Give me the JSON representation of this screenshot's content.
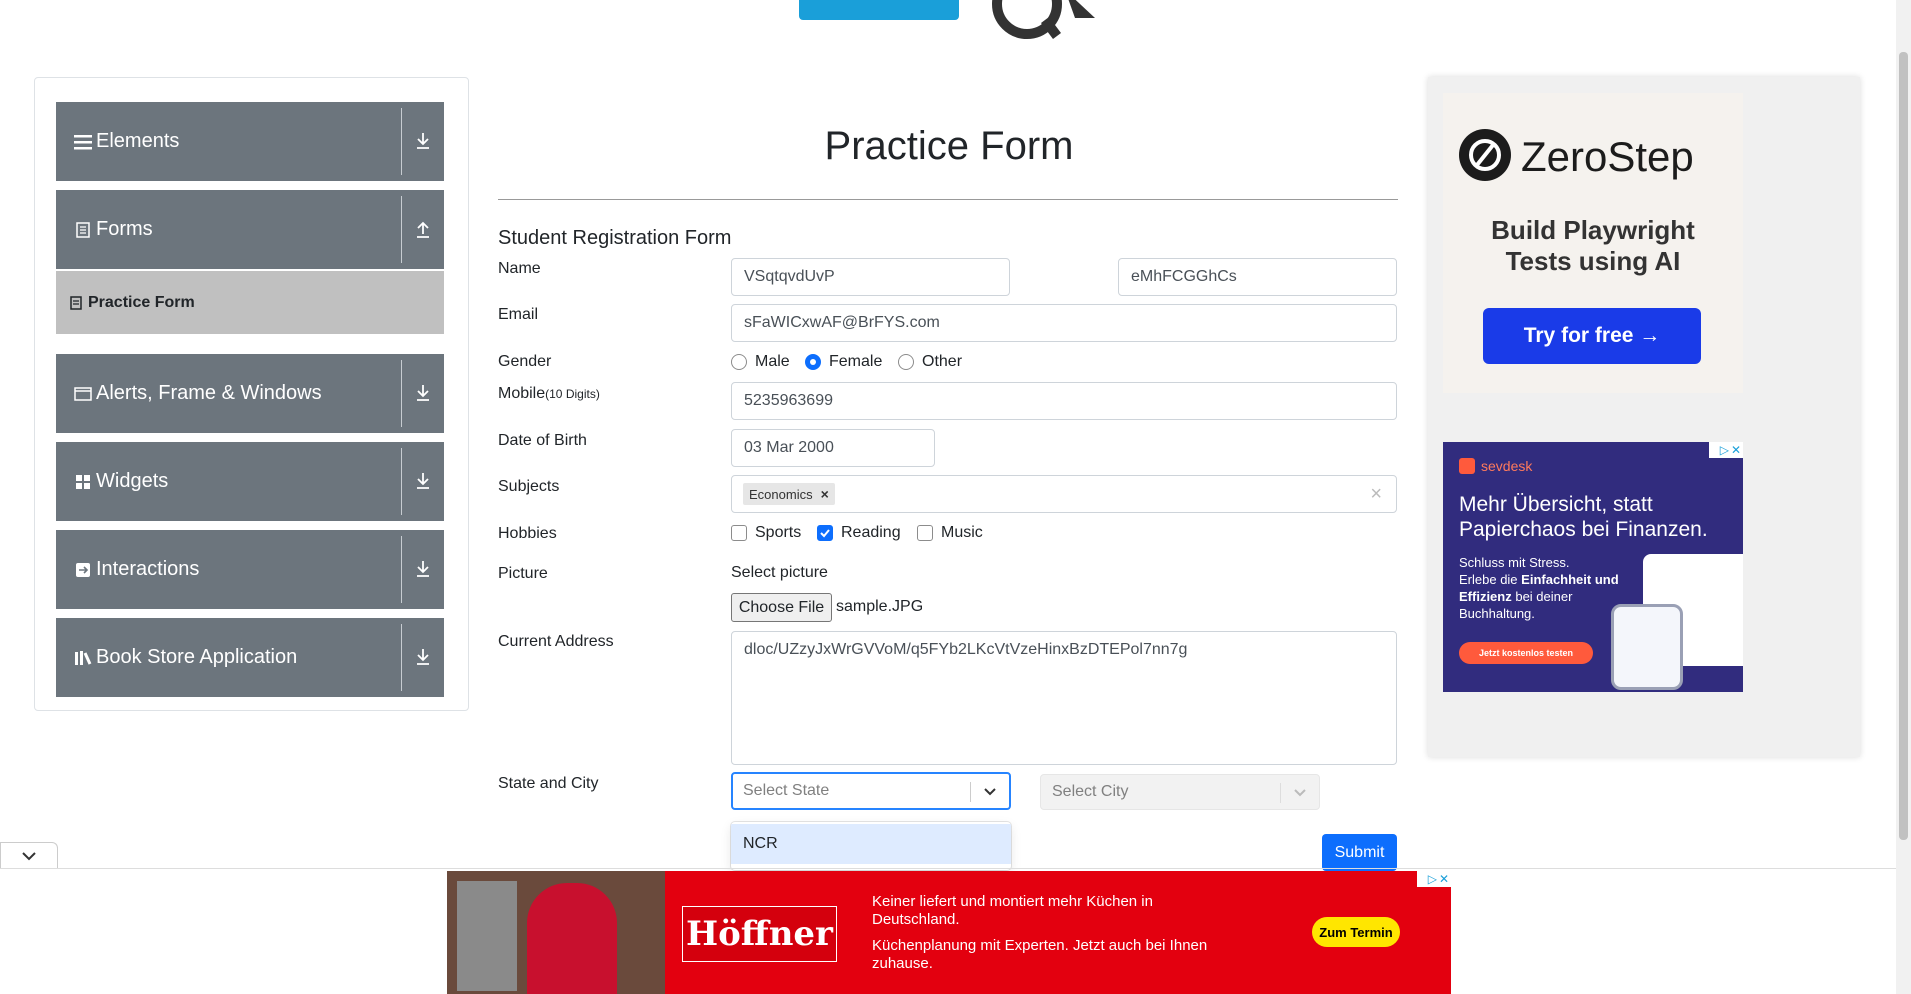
{
  "sidebar": {
    "groups": [
      {
        "label": "Elements",
        "icon": "list-icon",
        "arrow": "download-arrow-icon"
      },
      {
        "label": "Forms",
        "icon": "document-icon",
        "arrow": "upload-arrow-icon"
      },
      {
        "label": "Alerts, Frame & Windows",
        "icon": "window-icon",
        "arrow": "download-arrow-icon"
      },
      {
        "label": "Widgets",
        "icon": "widgets-icon",
        "arrow": "download-arrow-icon"
      },
      {
        "label": "Interactions",
        "icon": "interaction-icon",
        "arrow": "download-arrow-icon"
      },
      {
        "label": "Book Store Application",
        "icon": "books-icon",
        "arrow": "download-arrow-icon"
      }
    ],
    "active_item": "Practice Form"
  },
  "main": {
    "page_title": "Practice Form",
    "form_title": "Student Registration Form",
    "name_label": "Name",
    "first_name": "VSqtqvdUvP",
    "last_name": "eMhFCGGhCs",
    "email_label": "Email",
    "email": "sFaWICxwAF@BrFYS.com",
    "gender_label": "Gender",
    "gender_options": [
      "Male",
      "Female",
      "Other"
    ],
    "gender_selected": "Female",
    "mobile_label": "Mobile",
    "mobile_hint": "(10 Digits)",
    "mobile": "5235963699",
    "dob_label": "Date of Birth",
    "dob": "03 Mar 2000",
    "subjects_label": "Subjects",
    "subjects": [
      "Economics"
    ],
    "hobbies_label": "Hobbies",
    "hobbies": [
      "Sports",
      "Reading",
      "Music"
    ],
    "hobbies_checked": [
      "Reading"
    ],
    "picture_label": "Picture",
    "select_picture": "Select picture",
    "choose_file": "Choose File",
    "file_name": "sample.JPG",
    "address_label": "Current Address",
    "address": "dloc/UZzyJxWrGVVoM/q5FYb2LKcVtVzeHinxBzDTEPol7nn7g",
    "state_city_label": "State and City",
    "state_placeholder": "Select State",
    "city_placeholder": "Select City",
    "state_options_visible": [
      "NCR"
    ],
    "submit": "Submit"
  },
  "ads": {
    "zerostep": {
      "brand": "ZeroStep",
      "headline": "Build Playwright Tests using AI",
      "cta": "Try for free →"
    },
    "sevdesk": {
      "brand": "sevdesk",
      "headline": "Mehr Übersicht, statt Papierchaos bei Finanzen.",
      "body_1": "Schluss mit Stress.",
      "body_2": "Erlebe die ",
      "body_bold": "Einfachheit und Effizienz",
      "body_3": " bei deiner Buchhaltung.",
      "cta": "Jetzt kostenlos testen"
    },
    "hoeffner": {
      "brand": "Höffner",
      "line1": "Keiner liefert und montiert mehr Küchen in Deutschland.",
      "line2": "Küchenplanung mit Experten. Jetzt auch bei Ihnen zuhause.",
      "cta": "Zum Termin"
    }
  },
  "colors": {
    "accent": "#0d6efd",
    "sidebar": "#6c757d",
    "active_item": "#c0c0c0",
    "ad_red": "#e3000f",
    "sevdesk_bg": "#312c7e",
    "zerostep_btn": "#1a3be8"
  }
}
